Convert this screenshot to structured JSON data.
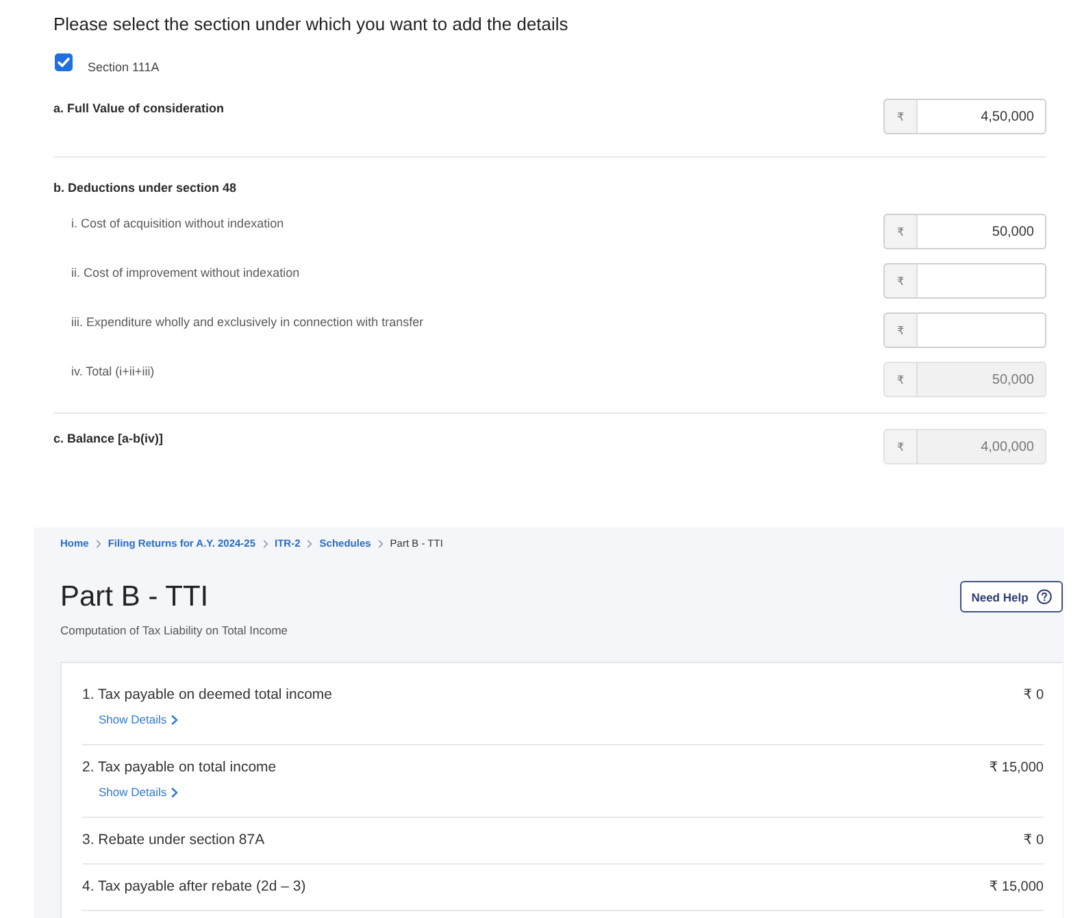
{
  "capital_gains": {
    "heading": "Please select the section under which you want to add the details",
    "section_checkbox": {
      "label": "Section 111A",
      "checked": true
    },
    "groups": [
      {
        "rows": [
          {
            "kind": "item",
            "label": "a. Full Value of consideration",
            "field": {
              "prefix": "₹",
              "value": "4,50,000",
              "disabled": false
            }
          }
        ]
      },
      {
        "rows": [
          {
            "kind": "heading",
            "label": "b. Deductions under section 48"
          },
          {
            "kind": "subitem",
            "label": "i. Cost of acquisition without indexation",
            "field": {
              "prefix": "₹",
              "value": "50,000",
              "disabled": false
            }
          },
          {
            "kind": "subitem",
            "label": "ii. Cost of improvement without indexation",
            "field": {
              "prefix": "₹",
              "disabled": false
            }
          },
          {
            "kind": "subitem",
            "label": "iii. Expenditure wholly and exclusively in connection with transfer",
            "field": {
              "prefix": "₹",
              "disabled": false
            }
          },
          {
            "kind": "subitem",
            "label": "iv. Total (i+ii+iii)",
            "field": {
              "prefix": "₹",
              "value": "50,000",
              "disabled": true
            }
          }
        ]
      },
      {
        "rows": [
          {
            "kind": "item",
            "label": "c. Balance [a-b(iv)]",
            "field": {
              "prefix": "₹",
              "value": "4,00,000",
              "disabled": true
            }
          }
        ]
      }
    ]
  },
  "part_b_tti": {
    "breadcrumb": [
      {
        "label": "Home",
        "current": false
      },
      {
        "label": "Filing Returns for A.Y. 2024-25",
        "current": false
      },
      {
        "label": "ITR-2",
        "current": false
      },
      {
        "label": "Schedules",
        "current": false
      },
      {
        "label": "Part B - TTI",
        "current": true
      }
    ],
    "title": "Part B - TTI",
    "help_button": {
      "label": "Need Help"
    },
    "subtitle": "Computation of Tax Liability on Total Income",
    "rows": [
      {
        "label": "1. Tax payable on deemed total income",
        "amount": "₹ 0",
        "details_link": "Show Details"
      },
      {
        "label": "2. Tax payable on total income",
        "amount": "₹ 15,000",
        "details_link": "Show Details"
      },
      {
        "label": "3. Rebate under section 87A",
        "amount": "₹ 0"
      },
      {
        "label": "4. Tax payable after rebate (2d – 3)",
        "amount": "₹ 15,000"
      }
    ]
  }
}
